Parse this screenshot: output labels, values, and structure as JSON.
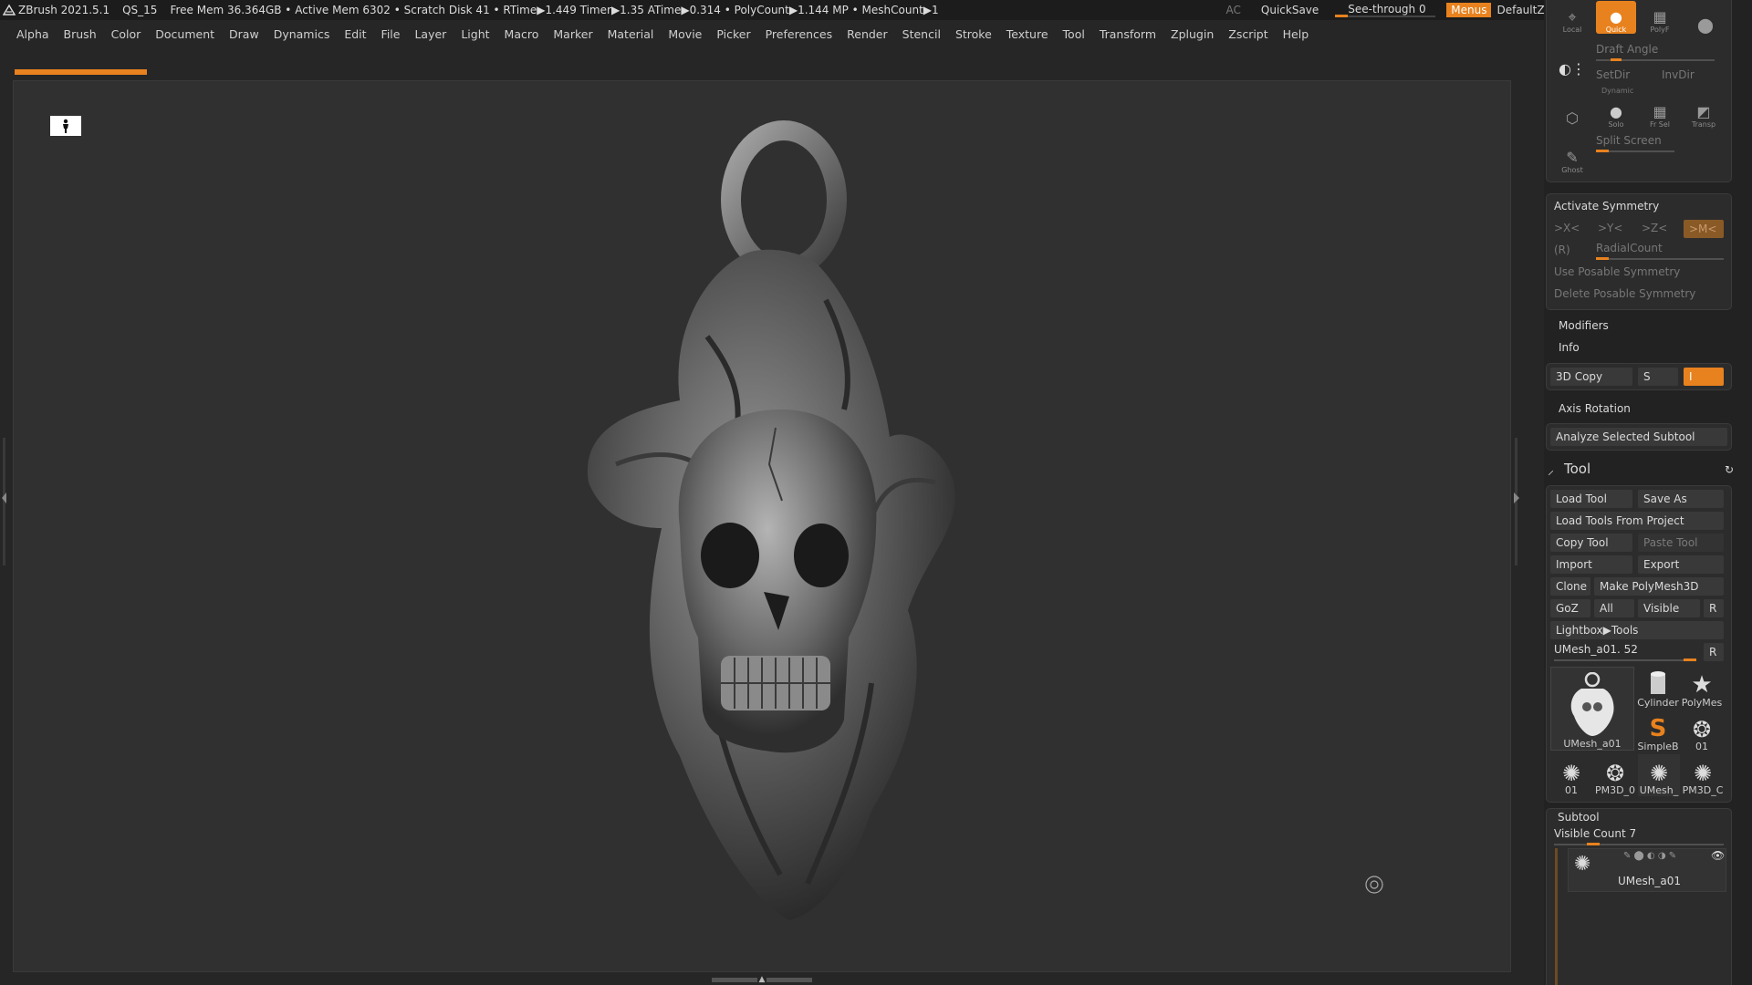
{
  "titlebar": {
    "app": "ZBrush 2021.5.1",
    "doc": "QS_15",
    "stats": "Free Mem 36.364GB • Active Mem 6302 • Scratch Disk 41 •  RTime▶1.449 Timer▶1.35 ATime▶0.314 • PolyCount▶1.144 MP  • MeshCount▶1",
    "ac": "AC",
    "quicksave": "QuickSave",
    "seethrough": "See-through  0",
    "seethrough_value": 0,
    "menus": "Menus",
    "default_zscript": "DefaultZscript"
  },
  "menubar": [
    "Alpha",
    "Brush",
    "Color",
    "Document",
    "Draw",
    "Dynamics",
    "Edit",
    "File",
    "Layer",
    "Light",
    "Macro",
    "Marker",
    "Material",
    "Movie",
    "Picker",
    "Preferences",
    "Render",
    "Stencil",
    "Stroke",
    "Texture",
    "Tool",
    "Transform",
    "Zplugin",
    "Zscript",
    "Help"
  ],
  "icons": {
    "person": "person-icon",
    "target": "target-icon",
    "model": "skull-pendant-model"
  },
  "panel": {
    "top": {
      "local": "Local",
      "quick": "Quick",
      "polyf": "PolyF",
      "draft_angle": "Draft Angle",
      "setdir": "SetDir",
      "invdir": "InvDir",
      "dynamic": "Dynamic",
      "solo": "Solo",
      "frsel": "Fr Sel",
      "transp": "Transp",
      "ghost": "Ghost",
      "split_screen": "Split Screen"
    },
    "symmetry": {
      "title": "Activate Symmetry",
      "x": ">X<",
      "y": ">Y<",
      "z": ">Z<",
      "m": ">M<",
      "r": "(R)",
      "radial": "RadialCount",
      "use_posable": "Use Posable Symmetry",
      "delete_posable": "Delete Posable Symmetry"
    },
    "modifiers": "Modifiers",
    "info": "Info",
    "copy3d": "3D Copy",
    "copy_s": "S",
    "copy_i": "I",
    "axis_rotation": "Axis Rotation",
    "analyze": "Analyze Selected Subtool",
    "tool": {
      "title": "Tool",
      "load_tool": "Load Tool",
      "save_as": "Save As",
      "load_from_project": "Load Tools From Project",
      "copy_tool": "Copy Tool",
      "paste_tool": "Paste Tool",
      "import": "Import",
      "export": "Export",
      "clone": "Clone",
      "make_polymesh": "Make PolyMesh3D",
      "goz": "GoZ",
      "all": "All",
      "visible": "Visible",
      "r": "R",
      "lightbox": "Lightbox▶Tools",
      "current": "UMesh_a01. 52",
      "current_r": "R",
      "thumbs": {
        "main": "UMesh_a01",
        "cylinder": "Cylinder",
        "polymesh": "PolyMes",
        "simpleb": "SimpleB",
        "t01a": "01",
        "t01b": "01",
        "pm3d1": "PM3D_0",
        "umesh": "UMesh_",
        "pm3d2": "PM3D_C"
      }
    },
    "subtool": {
      "title": "Subtool",
      "visible_count": "Visible Count 7",
      "item": "UMesh_a01"
    }
  },
  "colors": {
    "accent": "#e8821e",
    "background": "#262626",
    "panel": "#222222",
    "viewport": "#303030"
  }
}
